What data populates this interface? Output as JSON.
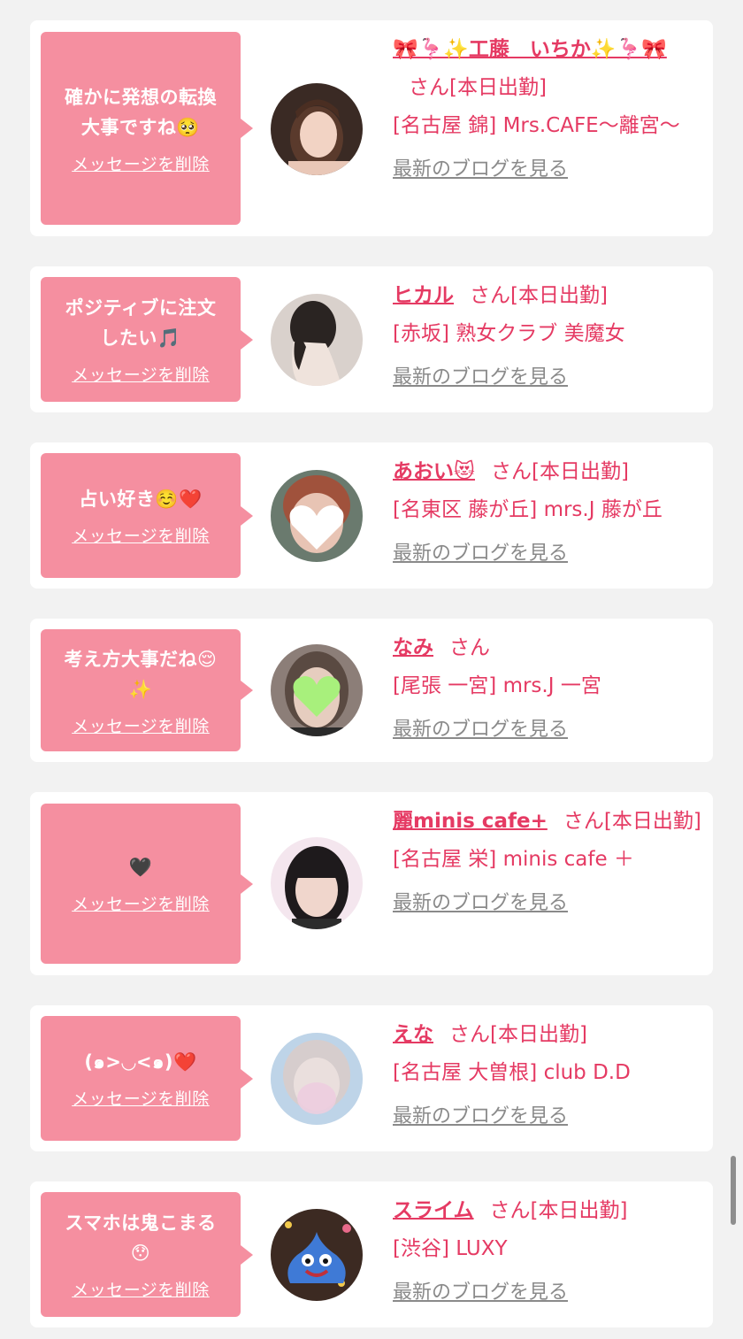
{
  "messages": [
    {
      "message": "確かに発想の転換\n大事ですね🥺",
      "delete_label": "メッセージを削除",
      "avatar": "woman-portrait-avatar",
      "name": "🎀🦩✨工藤　いちか✨🦩🎀",
      "honorific": "さん",
      "status": "[本日出勤]",
      "shop": "[名古屋 錦] Mrs.CAFE〜離宮〜",
      "blog_label": "最新のブログを見る"
    },
    {
      "message": "ポジティブに注文\nしたい🎵",
      "delete_label": "メッセージを削除",
      "avatar": "woman-back-avatar",
      "name": "ヒカル",
      "honorific": "さん",
      "status": "[本日出勤]",
      "shop": "[赤坂] 熟女クラブ 美魔女",
      "blog_label": "最新のブログを見る"
    },
    {
      "message": "占い好き☺️❤️",
      "delete_label": "メッセージを削除",
      "avatar": "white-heart-face-avatar",
      "name": "あおい😻",
      "honorific": "さん",
      "status": "[本日出勤]",
      "shop": "[名東区 藤が丘] mrs.J 藤が丘",
      "blog_label": "最新のブログを見る"
    },
    {
      "message": "考え方大事だね😌\n✨",
      "delete_label": "メッセージを削除",
      "avatar": "green-heart-face-avatar",
      "name": "なみ",
      "honorific": "さん",
      "status": "",
      "shop": "[尾張 一宮] mrs.J 一宮",
      "blog_label": "最新のブログを見る"
    },
    {
      "message": "🖤",
      "delete_label": "メッセージを削除",
      "avatar": "girl-bangs-avatar",
      "name": "麗minis cafe+",
      "honorific": "さん",
      "status": "[本日出勤]",
      "shop": "[名古屋 栄] minis cafe ＋",
      "blog_label": "最新のブログを見る"
    },
    {
      "message": "(๑>◡<๑)❤️",
      "delete_label": "メッセージを削除",
      "avatar": "blurred-face-avatar",
      "name": "えな",
      "honorific": "さん",
      "status": "[本日出勤]",
      "shop": "[名古屋 大曽根] club D.D",
      "blog_label": "最新のブログを見る"
    },
    {
      "message": "スマホは鬼こまる\n😯",
      "delete_label": "メッセージを削除",
      "avatar": "slime-avatar",
      "name": "スライム",
      "honorific": "さん",
      "status": "[本日出勤]",
      "shop": "[渋谷] LUXY",
      "blog_label": "最新のブログを見る"
    }
  ],
  "colors": {
    "background": "#f2f2f2",
    "card": "#ffffff",
    "bubble": "#f58fa0",
    "accent": "#e53a63",
    "link_gray": "#8a8a8a"
  }
}
